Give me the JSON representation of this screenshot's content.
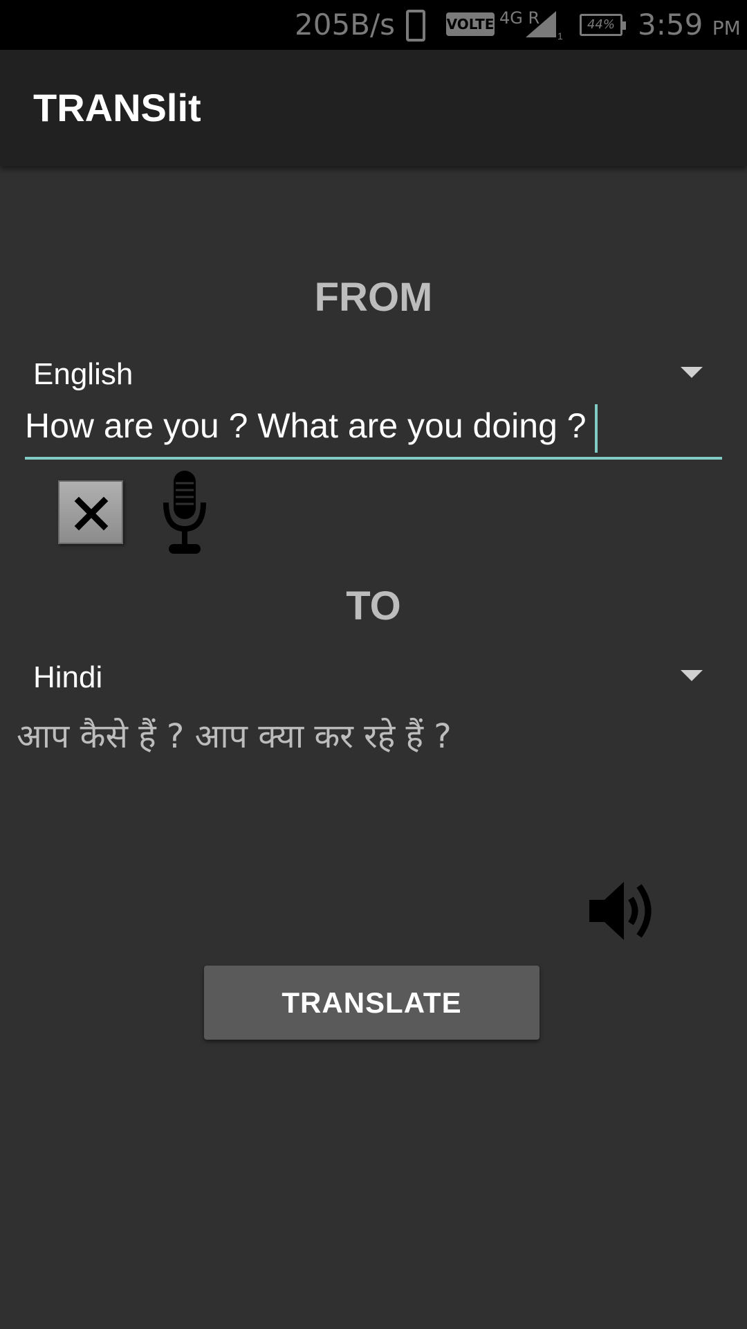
{
  "status_bar": {
    "speed": "205B/s",
    "volte": "VOLTE",
    "network": "4G R",
    "sim_slot": "1",
    "battery": "44%",
    "time": "3:59",
    "ampm": "PM"
  },
  "app_bar": {
    "title": "TRANSlit"
  },
  "from": {
    "label": "FROM",
    "language": "English",
    "input_value": "How are you ? What are you doing ?"
  },
  "actions": {
    "clear_icon": "close-icon",
    "mic_icon": "microphone-icon"
  },
  "to": {
    "label": "TO",
    "language": "Hindi",
    "output_text": "आप कैसे हैं ? आप क्या कर रहे हैं ?",
    "speaker_icon": "speaker-icon"
  },
  "translate_button": {
    "label": "TRANSLATE"
  },
  "colors": {
    "background": "#303030",
    "app_bar": "#212121",
    "accent": "#80cbc4",
    "button": "#5a5a5a"
  }
}
